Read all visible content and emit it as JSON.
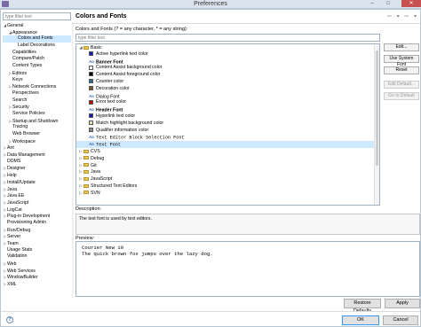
{
  "window": {
    "title": "Preferences",
    "minimize": "–",
    "maximize": "□",
    "close": "✕"
  },
  "left": {
    "filter_placeholder": "type filter text",
    "tree": [
      {
        "label": "General",
        "depth": 0,
        "state": "open"
      },
      {
        "label": "Appearance",
        "depth": 1,
        "state": "open"
      },
      {
        "label": "Colors and Fonts",
        "depth": 2,
        "state": "leaf",
        "selected": true
      },
      {
        "label": "Label Decorations",
        "depth": 2,
        "state": "leaf"
      },
      {
        "label": "Capabilities",
        "depth": 1,
        "state": "leaf"
      },
      {
        "label": "Compare/Patch",
        "depth": 1,
        "state": "leaf"
      },
      {
        "label": "Content Types",
        "depth": 1,
        "state": "leaf"
      },
      {
        "label": "Editors",
        "depth": 1,
        "state": "closed"
      },
      {
        "label": "Keys",
        "depth": 1,
        "state": "leaf"
      },
      {
        "label": "Network Connections",
        "depth": 1,
        "state": "closed"
      },
      {
        "label": "Perspectives",
        "depth": 1,
        "state": "leaf"
      },
      {
        "label": "Search",
        "depth": 1,
        "state": "leaf"
      },
      {
        "label": "Security",
        "depth": 1,
        "state": "closed"
      },
      {
        "label": "Service Policies",
        "depth": 1,
        "state": "leaf"
      },
      {
        "label": "Startup and Shutdown",
        "depth": 1,
        "state": "closed"
      },
      {
        "label": "Tracing",
        "depth": 1,
        "state": "leaf"
      },
      {
        "label": "Web Browser",
        "depth": 1,
        "state": "leaf"
      },
      {
        "label": "Workspace",
        "depth": 1,
        "state": "closed"
      },
      {
        "label": "Ant",
        "depth": 0,
        "state": "closed"
      },
      {
        "label": "Data Management",
        "depth": 0,
        "state": "closed"
      },
      {
        "label": "DDMS",
        "depth": 0,
        "state": "leaf"
      },
      {
        "label": "Designer",
        "depth": 0,
        "state": "closed"
      },
      {
        "label": "Help",
        "depth": 0,
        "state": "closed"
      },
      {
        "label": "Install/Update",
        "depth": 0,
        "state": "closed"
      },
      {
        "label": "Java",
        "depth": 0,
        "state": "closed"
      },
      {
        "label": "Java EE",
        "depth": 0,
        "state": "closed"
      },
      {
        "label": "JavaScript",
        "depth": 0,
        "state": "closed"
      },
      {
        "label": "LogCat",
        "depth": 0,
        "state": "closed"
      },
      {
        "label": "Plug-in Development",
        "depth": 0,
        "state": "closed"
      },
      {
        "label": "Provisioning Admin",
        "depth": 0,
        "state": "leaf"
      },
      {
        "label": "Run/Debug",
        "depth": 0,
        "state": "closed"
      },
      {
        "label": "Server",
        "depth": 0,
        "state": "closed"
      },
      {
        "label": "Team",
        "depth": 0,
        "state": "closed"
      },
      {
        "label": "Usage Stats",
        "depth": 0,
        "state": "leaf"
      },
      {
        "label": "Validation",
        "depth": 0,
        "state": "leaf"
      },
      {
        "label": "Web",
        "depth": 0,
        "state": "closed"
      },
      {
        "label": "Web Services",
        "depth": 0,
        "state": "closed"
      },
      {
        "label": "WindowBuilder",
        "depth": 0,
        "state": "closed"
      },
      {
        "label": "XML",
        "depth": 0,
        "state": "closed"
      }
    ]
  },
  "main": {
    "title": "Colors and Fonts",
    "nav_arrows": "⇦ ▾ ⇨ ▾",
    "caption": "Colors and Fonts (? = any character, * = any string):",
    "filter_placeholder": "type filter text",
    "items": [
      {
        "label": "Basic",
        "kind": "folder",
        "state": "open",
        "depth": 0
      },
      {
        "label": "Active hyperlink text color",
        "kind": "color",
        "color": "#1018b8",
        "depth": 1
      },
      {
        "label": "Banner Font",
        "kind": "font",
        "bold": true,
        "depth": 1
      },
      {
        "label": "Content Assist background color",
        "kind": "color",
        "color": "#ffffff",
        "depth": 1
      },
      {
        "label": "Content Assist foreground color",
        "kind": "color",
        "color": "#000000",
        "depth": 1
      },
      {
        "label": "Counter color",
        "kind": "color",
        "color": "#2c6e8a",
        "depth": 1
      },
      {
        "label": "Decoration color",
        "kind": "color",
        "color": "#7a5a2a",
        "depth": 1
      },
      {
        "label": "Dialog Font",
        "kind": "font",
        "depth": 1
      },
      {
        "label": "Error text color",
        "kind": "color",
        "color": "#cc0000",
        "depth": 1
      },
      {
        "label": "Header Font",
        "kind": "font",
        "bold": true,
        "depth": 1
      },
      {
        "label": "Hyperlink text color",
        "kind": "color",
        "color": "#1018b8",
        "depth": 1
      },
      {
        "label": "Match highlight background color",
        "kind": "color",
        "color": "#e8e2b8",
        "depth": 1
      },
      {
        "label": "Qualifier information color",
        "kind": "color",
        "color": "#8a8a8a",
        "depth": 1
      },
      {
        "label": "Text Editor Block Selection Font",
        "kind": "font",
        "mono": true,
        "depth": 1
      },
      {
        "label": "Text Font",
        "kind": "font",
        "mono": true,
        "selected": true,
        "depth": 1
      },
      {
        "label": "CVS",
        "kind": "folder",
        "state": "closed",
        "depth": 0
      },
      {
        "label": "Debug",
        "kind": "folder",
        "state": "closed",
        "depth": 0
      },
      {
        "label": "Git",
        "kind": "folder",
        "state": "closed",
        "depth": 0
      },
      {
        "label": "Java",
        "kind": "folder",
        "state": "closed",
        "depth": 0
      },
      {
        "label": "JavaScript",
        "kind": "folder",
        "state": "closed",
        "depth": 0
      },
      {
        "label": "Structured Text Editors",
        "kind": "folder",
        "state": "closed",
        "depth": 0
      },
      {
        "label": "SVN",
        "kind": "folder",
        "state": "closed",
        "depth": 0
      }
    ],
    "buttons": {
      "edit": "Edit...",
      "use_system_font": "Use System Font",
      "reset": "Reset",
      "edit_default": "Edit Default...",
      "go_to_default": "Go to Default"
    },
    "description_label": "Description:",
    "description_text": "The text font is used by text editors.",
    "preview_label": "Preview:",
    "preview_lines": [
      "Courier New 10",
      "The quick brown fox jumps over the lazy dog."
    ],
    "restore_defaults": "Restore Defaults",
    "apply": "Apply"
  },
  "footer": {
    "help_icon": "?",
    "ok": "OK",
    "cancel": "Cancel"
  }
}
